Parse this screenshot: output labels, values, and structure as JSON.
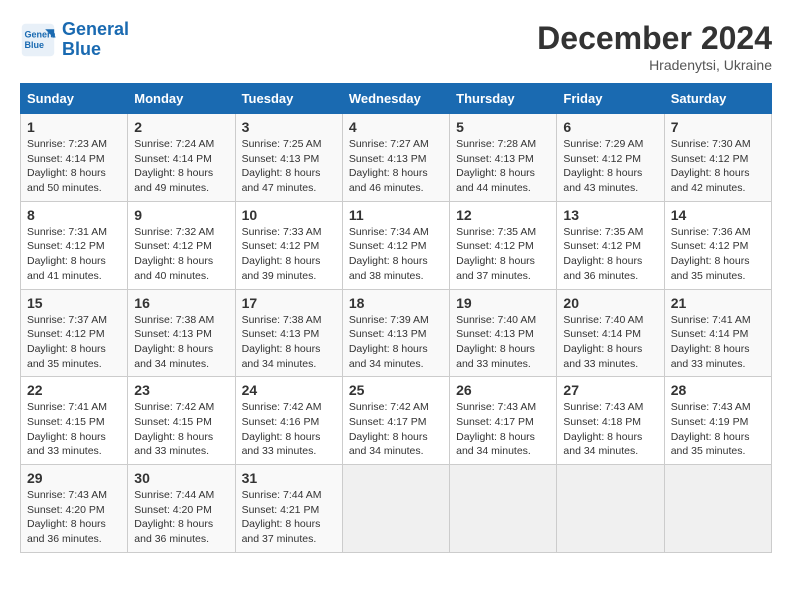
{
  "header": {
    "logo_line1": "General",
    "logo_line2": "Blue",
    "month_title": "December 2024",
    "subtitle": "Hradenytsi, Ukraine"
  },
  "days_of_week": [
    "Sunday",
    "Monday",
    "Tuesday",
    "Wednesday",
    "Thursday",
    "Friday",
    "Saturday"
  ],
  "weeks": [
    [
      {
        "day": "1",
        "sunrise": "Sunrise: 7:23 AM",
        "sunset": "Sunset: 4:14 PM",
        "daylight": "Daylight: 8 hours and 50 minutes."
      },
      {
        "day": "2",
        "sunrise": "Sunrise: 7:24 AM",
        "sunset": "Sunset: 4:14 PM",
        "daylight": "Daylight: 8 hours and 49 minutes."
      },
      {
        "day": "3",
        "sunrise": "Sunrise: 7:25 AM",
        "sunset": "Sunset: 4:13 PM",
        "daylight": "Daylight: 8 hours and 47 minutes."
      },
      {
        "day": "4",
        "sunrise": "Sunrise: 7:27 AM",
        "sunset": "Sunset: 4:13 PM",
        "daylight": "Daylight: 8 hours and 46 minutes."
      },
      {
        "day": "5",
        "sunrise": "Sunrise: 7:28 AM",
        "sunset": "Sunset: 4:13 PM",
        "daylight": "Daylight: 8 hours and 44 minutes."
      },
      {
        "day": "6",
        "sunrise": "Sunrise: 7:29 AM",
        "sunset": "Sunset: 4:12 PM",
        "daylight": "Daylight: 8 hours and 43 minutes."
      },
      {
        "day": "7",
        "sunrise": "Sunrise: 7:30 AM",
        "sunset": "Sunset: 4:12 PM",
        "daylight": "Daylight: 8 hours and 42 minutes."
      }
    ],
    [
      {
        "day": "8",
        "sunrise": "Sunrise: 7:31 AM",
        "sunset": "Sunset: 4:12 PM",
        "daylight": "Daylight: 8 hours and 41 minutes."
      },
      {
        "day": "9",
        "sunrise": "Sunrise: 7:32 AM",
        "sunset": "Sunset: 4:12 PM",
        "daylight": "Daylight: 8 hours and 40 minutes."
      },
      {
        "day": "10",
        "sunrise": "Sunrise: 7:33 AM",
        "sunset": "Sunset: 4:12 PM",
        "daylight": "Daylight: 8 hours and 39 minutes."
      },
      {
        "day": "11",
        "sunrise": "Sunrise: 7:34 AM",
        "sunset": "Sunset: 4:12 PM",
        "daylight": "Daylight: 8 hours and 38 minutes."
      },
      {
        "day": "12",
        "sunrise": "Sunrise: 7:35 AM",
        "sunset": "Sunset: 4:12 PM",
        "daylight": "Daylight: 8 hours and 37 minutes."
      },
      {
        "day": "13",
        "sunrise": "Sunrise: 7:35 AM",
        "sunset": "Sunset: 4:12 PM",
        "daylight": "Daylight: 8 hours and 36 minutes."
      },
      {
        "day": "14",
        "sunrise": "Sunrise: 7:36 AM",
        "sunset": "Sunset: 4:12 PM",
        "daylight": "Daylight: 8 hours and 35 minutes."
      }
    ],
    [
      {
        "day": "15",
        "sunrise": "Sunrise: 7:37 AM",
        "sunset": "Sunset: 4:12 PM",
        "daylight": "Daylight: 8 hours and 35 minutes."
      },
      {
        "day": "16",
        "sunrise": "Sunrise: 7:38 AM",
        "sunset": "Sunset: 4:13 PM",
        "daylight": "Daylight: 8 hours and 34 minutes."
      },
      {
        "day": "17",
        "sunrise": "Sunrise: 7:38 AM",
        "sunset": "Sunset: 4:13 PM",
        "daylight": "Daylight: 8 hours and 34 minutes."
      },
      {
        "day": "18",
        "sunrise": "Sunrise: 7:39 AM",
        "sunset": "Sunset: 4:13 PM",
        "daylight": "Daylight: 8 hours and 34 minutes."
      },
      {
        "day": "19",
        "sunrise": "Sunrise: 7:40 AM",
        "sunset": "Sunset: 4:13 PM",
        "daylight": "Daylight: 8 hours and 33 minutes."
      },
      {
        "day": "20",
        "sunrise": "Sunrise: 7:40 AM",
        "sunset": "Sunset: 4:14 PM",
        "daylight": "Daylight: 8 hours and 33 minutes."
      },
      {
        "day": "21",
        "sunrise": "Sunrise: 7:41 AM",
        "sunset": "Sunset: 4:14 PM",
        "daylight": "Daylight: 8 hours and 33 minutes."
      }
    ],
    [
      {
        "day": "22",
        "sunrise": "Sunrise: 7:41 AM",
        "sunset": "Sunset: 4:15 PM",
        "daylight": "Daylight: 8 hours and 33 minutes."
      },
      {
        "day": "23",
        "sunrise": "Sunrise: 7:42 AM",
        "sunset": "Sunset: 4:15 PM",
        "daylight": "Daylight: 8 hours and 33 minutes."
      },
      {
        "day": "24",
        "sunrise": "Sunrise: 7:42 AM",
        "sunset": "Sunset: 4:16 PM",
        "daylight": "Daylight: 8 hours and 33 minutes."
      },
      {
        "day": "25",
        "sunrise": "Sunrise: 7:42 AM",
        "sunset": "Sunset: 4:17 PM",
        "daylight": "Daylight: 8 hours and 34 minutes."
      },
      {
        "day": "26",
        "sunrise": "Sunrise: 7:43 AM",
        "sunset": "Sunset: 4:17 PM",
        "daylight": "Daylight: 8 hours and 34 minutes."
      },
      {
        "day": "27",
        "sunrise": "Sunrise: 7:43 AM",
        "sunset": "Sunset: 4:18 PM",
        "daylight": "Daylight: 8 hours and 34 minutes."
      },
      {
        "day": "28",
        "sunrise": "Sunrise: 7:43 AM",
        "sunset": "Sunset: 4:19 PM",
        "daylight": "Daylight: 8 hours and 35 minutes."
      }
    ],
    [
      {
        "day": "29",
        "sunrise": "Sunrise: 7:43 AM",
        "sunset": "Sunset: 4:20 PM",
        "daylight": "Daylight: 8 hours and 36 minutes."
      },
      {
        "day": "30",
        "sunrise": "Sunrise: 7:44 AM",
        "sunset": "Sunset: 4:20 PM",
        "daylight": "Daylight: 8 hours and 36 minutes."
      },
      {
        "day": "31",
        "sunrise": "Sunrise: 7:44 AM",
        "sunset": "Sunset: 4:21 PM",
        "daylight": "Daylight: 8 hours and 37 minutes."
      },
      null,
      null,
      null,
      null
    ]
  ]
}
